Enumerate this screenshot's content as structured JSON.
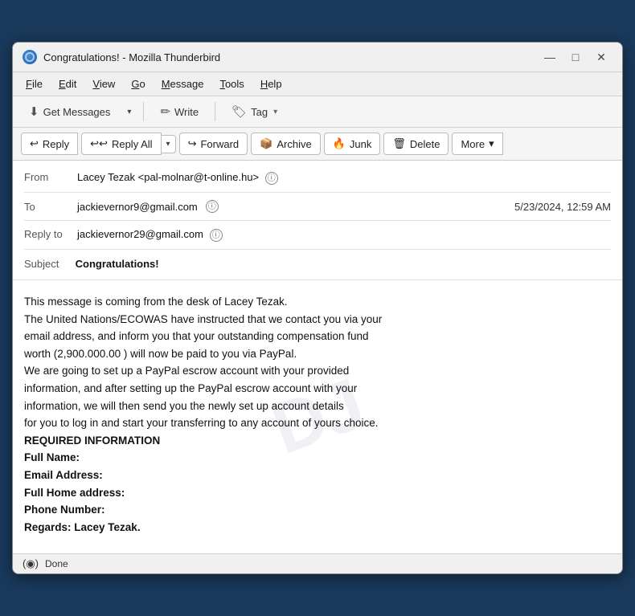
{
  "window": {
    "title": "Congratulations! - Mozilla Thunderbird",
    "icon": "thunderbird-icon"
  },
  "title_controls": {
    "minimize": "—",
    "maximize": "□",
    "close": "✕"
  },
  "menu": {
    "items": [
      {
        "label": "File",
        "underline_index": 0
      },
      {
        "label": "Edit",
        "underline_index": 0
      },
      {
        "label": "View",
        "underline_index": 0
      },
      {
        "label": "Go",
        "underline_index": 0
      },
      {
        "label": "Message",
        "underline_index": 0
      },
      {
        "label": "Tools",
        "underline_index": 0
      },
      {
        "label": "Help",
        "underline_index": 0
      }
    ]
  },
  "toolbar": {
    "get_messages": "Get Messages",
    "get_messages_icon": "↓",
    "write": "Write",
    "write_icon": "✏",
    "tag": "Tag",
    "tag_icon": "🏷"
  },
  "actions": {
    "reply": "Reply",
    "reply_icon": "↩",
    "reply_all": "Reply All",
    "reply_all_icon": "↩↩",
    "forward": "Forward",
    "forward_icon": "↪",
    "archive": "Archive",
    "archive_icon": "📦",
    "junk": "Junk",
    "junk_icon": "🔥",
    "delete": "Delete",
    "delete_icon": "🗑",
    "more": "More",
    "dropdown_arrow": "▾"
  },
  "email": {
    "from_label": "From",
    "from_value": "Lacey Tezak <pal-molnar@t-online.hu>",
    "to_label": "To",
    "to_value": "jackievernor9@gmail.com",
    "date": "5/23/2024, 12:59 AM",
    "reply_to_label": "Reply to",
    "reply_to_value": "jackievernor29@gmail.com",
    "subject_label": "Subject",
    "subject_value": "Congratulations!",
    "body": "This message is coming from the desk of Lacey Tezak.\nThe United Nations/ECOWAS have instructed that we contact you via your\nemail address, and inform you that your outstanding compensation fund\nworth (2,900.000.00 ) will now be paid to you via PayPal.\nWe are going to set up a PayPal escrow account with your provided\ninformation, and after setting up the PayPal escrow account with your\ninformation, we will then send you the newly set up account details\nfor you to log in and start your transferring to any account of yours choice.\nREQUIRED INFORMATION\nFull Name:\nEmail Address:\nFull Home address:\nPhone Number:\nRegards: Lacey Tezak."
  },
  "status": {
    "icon": "(◉)",
    "text": "Done"
  }
}
